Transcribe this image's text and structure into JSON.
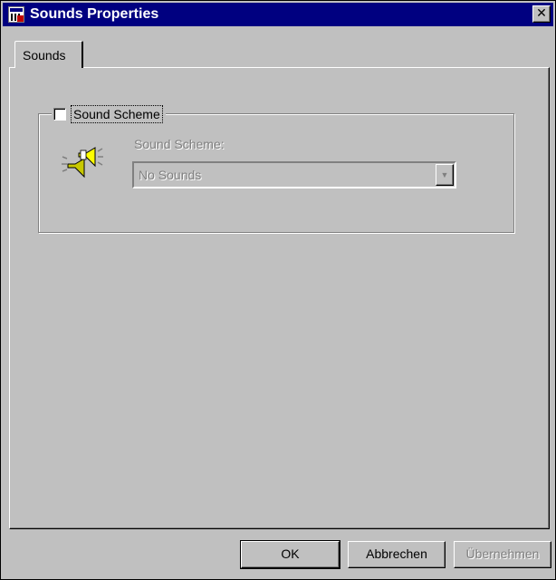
{
  "window": {
    "title": "Sounds Properties",
    "close_glyph": "✕"
  },
  "tabs": [
    {
      "label": "Sounds",
      "selected": true
    }
  ],
  "group": {
    "checkbox_label": "Sound Scheme",
    "checked": false,
    "icon": "speaker-icon",
    "scheme_label": "Sound Scheme:",
    "scheme_value": "No Sounds",
    "enabled": false
  },
  "buttons": {
    "ok": "OK",
    "cancel": "Abbrechen",
    "apply": "Übernehmen"
  },
  "colors": {
    "face": "#c0c0c0",
    "title_bar": "#000080",
    "disabled_text": "#808080"
  }
}
